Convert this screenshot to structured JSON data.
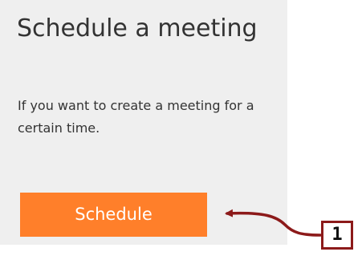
{
  "card": {
    "title": "Schedule a meeting",
    "description": "If you want to create a meeting for a certain time.",
    "button_label": "Schedule"
  },
  "annotation": {
    "callout_number": "1",
    "arrow_color": "#8c1a1a"
  },
  "colors": {
    "card_background": "#efefef",
    "button_background": "#ff7f2a",
    "button_text": "#ffffff",
    "text": "#333333"
  }
}
